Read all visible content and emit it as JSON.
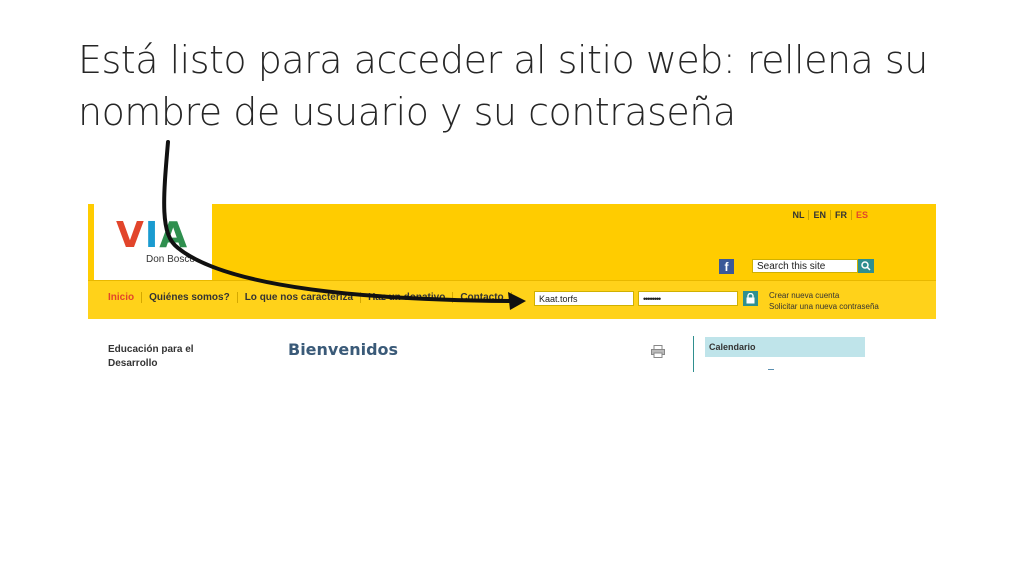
{
  "slide": {
    "title": "Está listo para acceder al sitio web: rellena su nombre de usuario y su contraseña"
  },
  "site": {
    "logo": {
      "text": "VIA",
      "subtitle": "Don Bosco"
    },
    "languages": [
      "NL",
      "EN",
      "FR",
      "ES"
    ],
    "search": {
      "placeholder": "Search this site"
    },
    "nav": [
      "Inicio",
      "Quiénes somos?",
      "Lo que nos caracteriza",
      "Haz un donativo",
      "Contacto"
    ],
    "login": {
      "username_value": "Kaat.torfs",
      "password_value": "••••••••",
      "create_account": "Crear nueva cuenta",
      "request_password": "Solicitar una nueva contraseña"
    },
    "sidebar_title": "Educación para el Desarrollo",
    "welcome": "Bienvenidos",
    "calendar": "Calendario"
  },
  "colors": {
    "brand_yellow": "#ffcc00",
    "accent_red": "#e2452b",
    "teal": "#2f8f8f"
  }
}
